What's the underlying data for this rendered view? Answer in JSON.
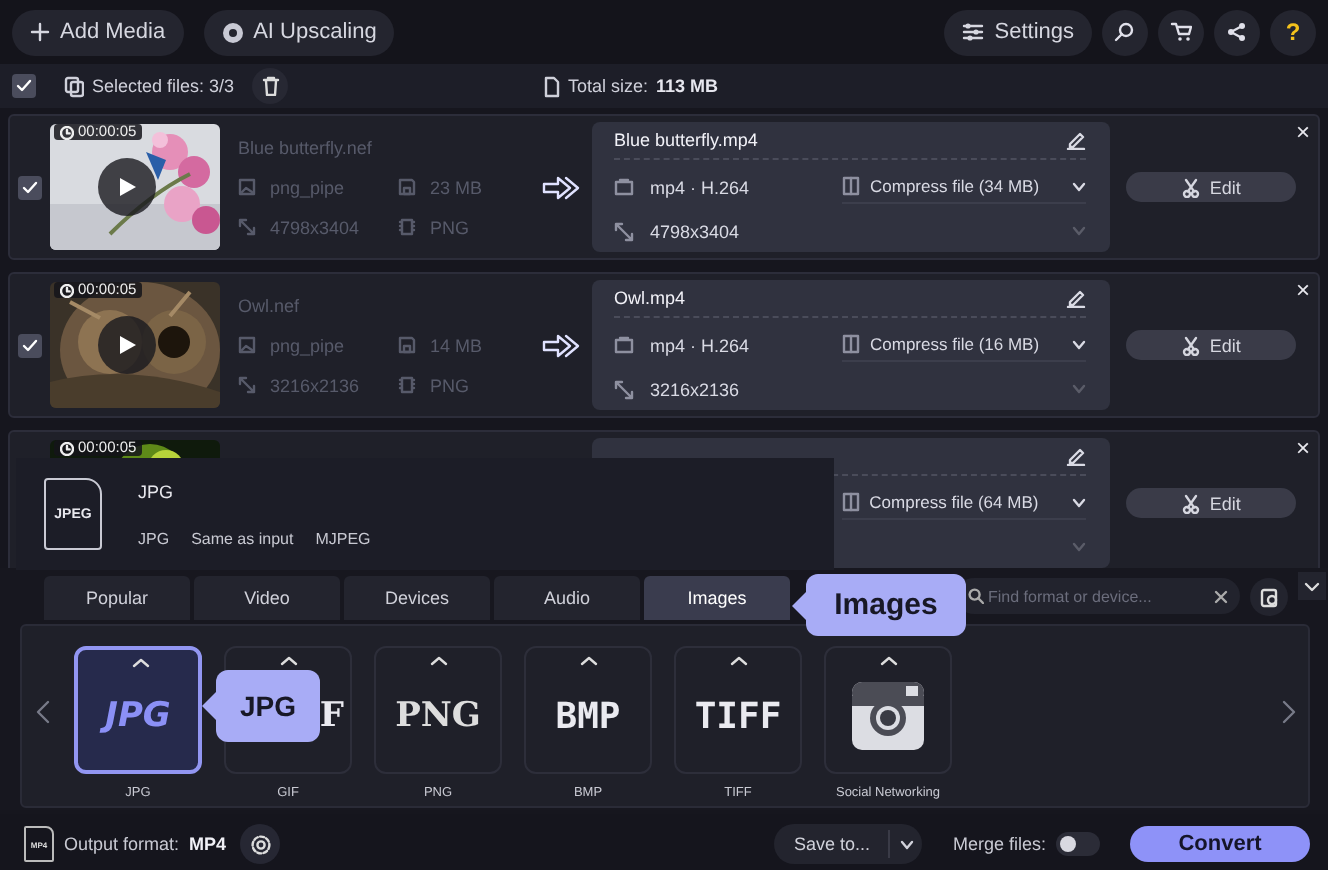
{
  "toolbar": {
    "buttons": [
      {
        "label": "Add Media",
        "kind": "add"
      },
      {
        "label": "AI Upscaling",
        "kind": "ai"
      }
    ],
    "settings": "Settings",
    "help": "?"
  },
  "selection": {
    "checked": true,
    "selected_files": "Selected files: 3/3",
    "total_label": "Total size:",
    "total_value": "113 MB"
  },
  "files": [
    {
      "checked": true,
      "duration": "00:00:05",
      "play": true,
      "name": "Blue butterfly.nef",
      "codec": "png_pipe",
      "size": "23 MB",
      "resolution": "4798x3404",
      "format": "PNG",
      "output": {
        "name": "Blue butterfly.mp4",
        "codec": "mp4 · H.264",
        "compress": "Compress file (34 MB)",
        "resolution": "4798x3404"
      },
      "edit": "Edit",
      "close": "×"
    },
    {
      "checked": true,
      "duration": "00:00:05",
      "play": true,
      "name": "Owl.nef",
      "codec": "png_pipe",
      "size": "14 MB",
      "resolution": "3216x2136",
      "format": "PNG",
      "output": {
        "name": "Owl.mp4",
        "codec": "mp4 · H.264",
        "compress": "Compress file (16 MB)",
        "resolution": "3216x2136"
      },
      "edit": "Edit",
      "close": "×"
    },
    {
      "duration": "00:00:05",
      "output": {
        "compress": "Compress file (64 MB)"
      },
      "edit": "Edit",
      "close": "×"
    }
  ],
  "format_popup": {
    "icon": "JPEG",
    "title": "JPG",
    "details": [
      "JPG",
      "Same as input",
      "MJPEG"
    ]
  },
  "format_panel": {
    "tabs": [
      {
        "label": "Popular",
        "selected": false
      },
      {
        "label": "Video",
        "selected": false
      },
      {
        "label": "Devices",
        "selected": false
      },
      {
        "label": "Audio",
        "selected": false
      },
      {
        "label": "Images",
        "selected": true
      }
    ],
    "tab_tooltip": "Images",
    "search": {
      "placeholder": "Find format or device..."
    },
    "formats": [
      {
        "kind": "text",
        "logo": "JPG",
        "label": "JPG",
        "selected": true
      },
      {
        "kind": "text",
        "logo": "F",
        "label": "GIF",
        "selected": false
      },
      {
        "kind": "text",
        "logo": "PNG",
        "label": "PNG",
        "selected": false
      },
      {
        "kind": "text",
        "logo": "BMP",
        "label": "BMP",
        "selected": false
      },
      {
        "kind": "text",
        "logo": "TIFF",
        "label": "TIFF",
        "selected": false
      },
      {
        "kind": "camera",
        "label": "Social Networking",
        "selected": false
      }
    ],
    "format_tooltip": "JPG"
  },
  "status_bar": {
    "file_icon": "MP4",
    "output_label": "Output format:",
    "output_value": "MP4",
    "save_to": "Save to...",
    "merge_label": "Merge files:",
    "merge_on": false,
    "convert": "Convert"
  }
}
